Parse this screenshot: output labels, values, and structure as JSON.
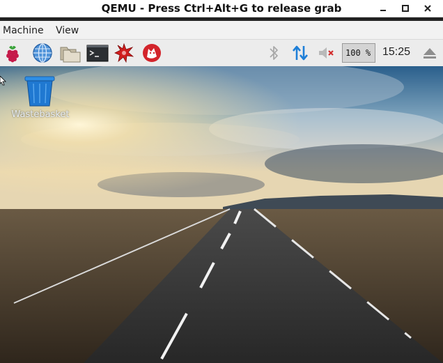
{
  "window": {
    "title": "QEMU - Press Ctrl+Alt+G to release grab"
  },
  "menu": {
    "machine": "Machine",
    "view": "View"
  },
  "panel": {
    "cpu_label": "100 %",
    "clock": "15:25"
  },
  "desktop": {
    "wastebasket_label": "Wastebasket"
  },
  "colors": {
    "accent": "#1e7fd8",
    "raspberry": "#c51a4a",
    "panel_bg": "#ececec"
  },
  "icons": [
    "raspberry-menu-icon",
    "web-browser-icon",
    "file-manager-icon",
    "terminal-icon",
    "mathematica-icon",
    "wolfram-icon",
    "bluetooth-icon",
    "network-icon",
    "volume-muted-icon",
    "eject-icon",
    "wastebasket-icon"
  ]
}
